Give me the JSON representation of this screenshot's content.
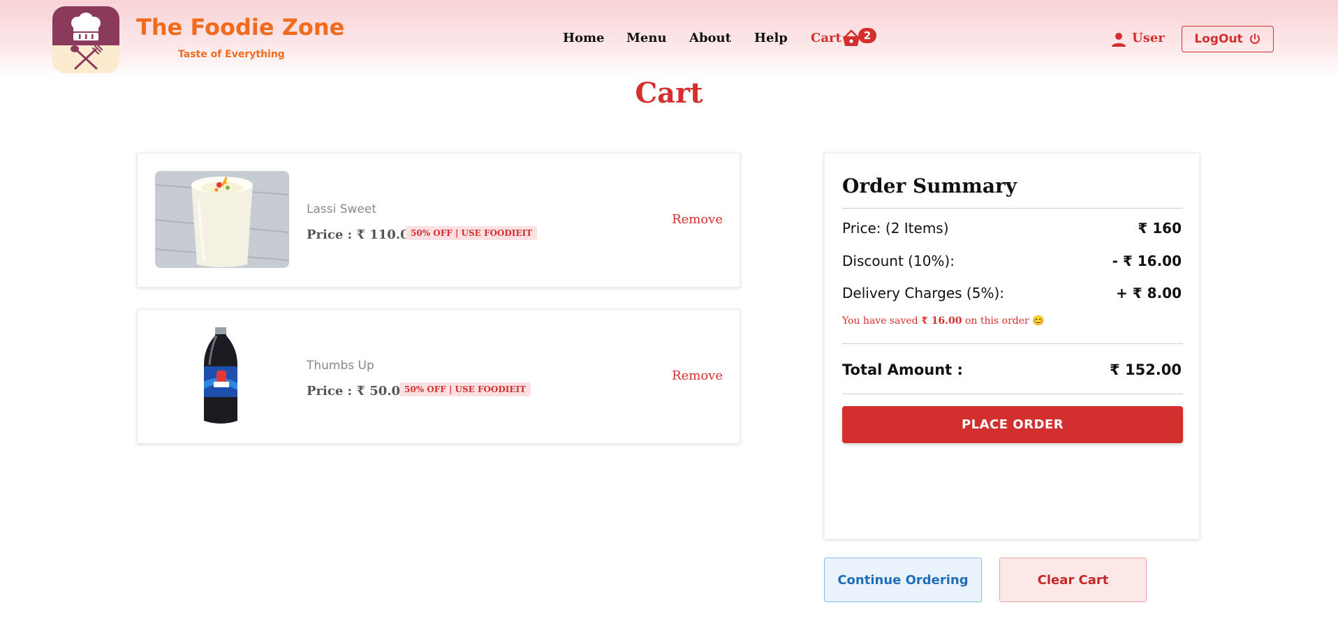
{
  "brand": {
    "name": "The Foodie Zone",
    "tagline": "Taste of Everything"
  },
  "nav": {
    "home": "Home",
    "menu": "Menu",
    "about": "About",
    "help": "Help",
    "cart": "Cart",
    "cart_count": "2",
    "user": "User",
    "logout": "LogOut"
  },
  "page": {
    "title": "Cart"
  },
  "cart_items": [
    {
      "name": "Lassi Sweet",
      "price_prefix": "Price : ",
      "price": "₹ 110.00",
      "offer": "50% OFF | USE FOODIEIT",
      "remove": "Remove",
      "image": "lassi-glass"
    },
    {
      "name": "Thumbs Up",
      "price_prefix": "Price : ",
      "price": "₹ 50.00",
      "offer": "50% OFF | USE FOODIEIT",
      "remove": "Remove",
      "image": "soda-bottle"
    }
  ],
  "summary": {
    "title": "Order Summary",
    "price_label": "Price: (2 Items)",
    "price_value": "₹ 160",
    "discount_label": "Discount (10%):",
    "discount_value": "- ₹ 16.00",
    "delivery_label": "Delivery Charges (5%):",
    "delivery_value": "+ ₹ 8.00",
    "saved_prefix": "You have saved ",
    "saved_amount": "₹ 16.00",
    "saved_suffix": " on this order",
    "saved_emoji": "😊",
    "total_label": "Total Amount :",
    "total_value": "₹ 152.00",
    "place_order": "PLACE ORDER"
  },
  "actions": {
    "continue": "Continue Ordering",
    "clear": "Clear Cart"
  },
  "colors": {
    "accent_red": "#d32f2f",
    "brand_orange": "#f26b1d",
    "logo_plum": "#8b3a5c",
    "continue_blue": "#1f6fb8"
  }
}
